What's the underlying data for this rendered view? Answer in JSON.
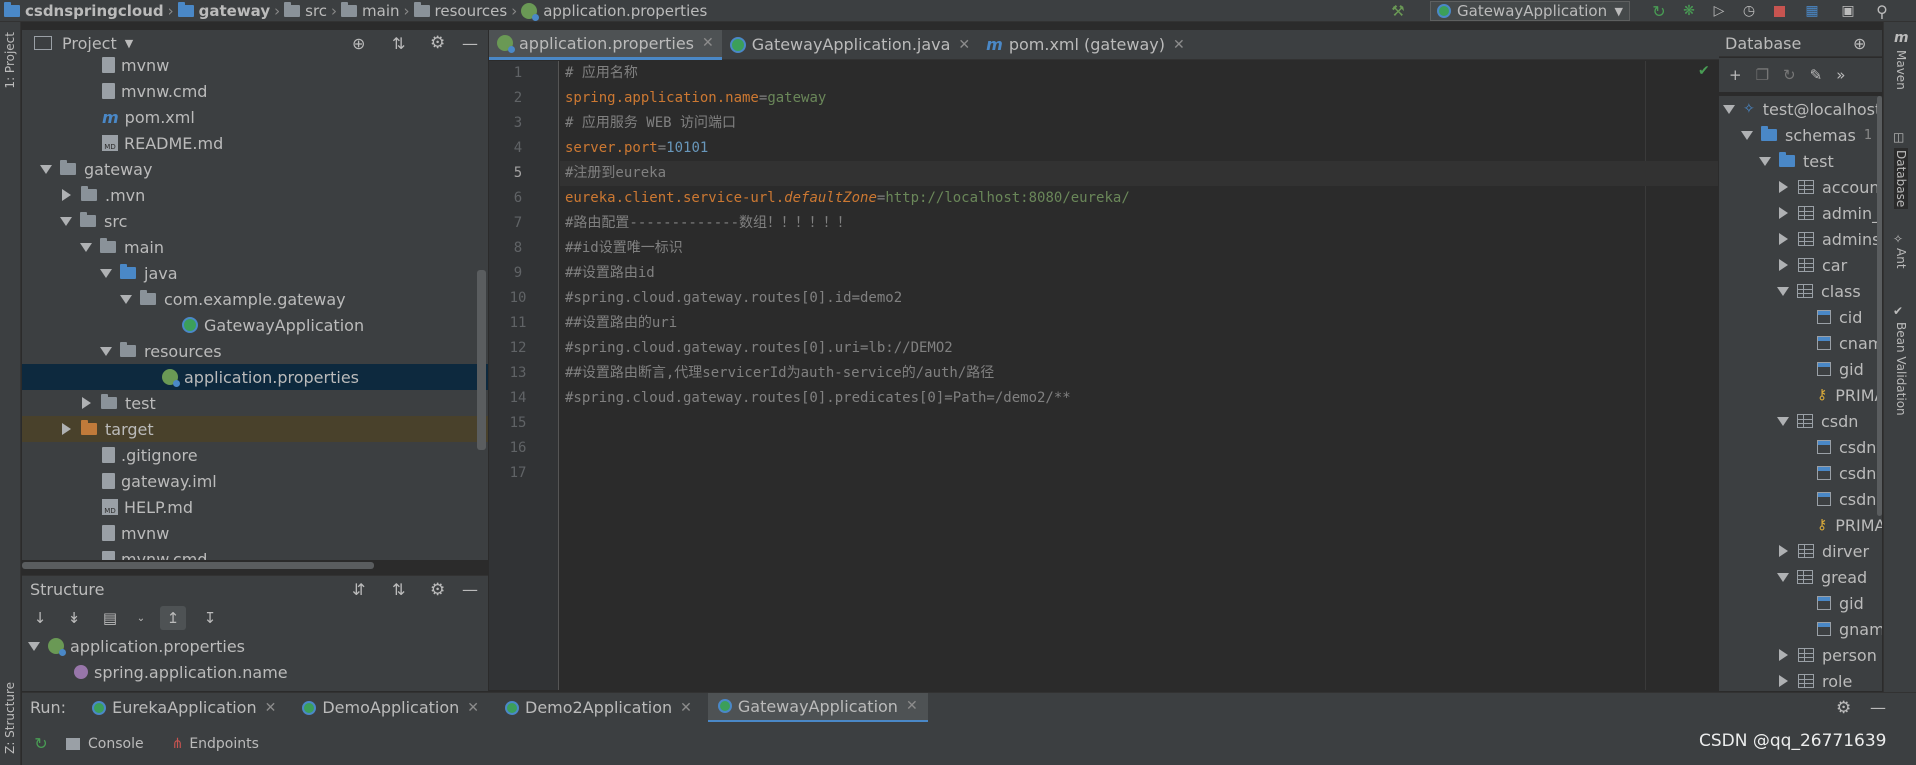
{
  "navbar": {
    "crumbs": [
      "csdnspringcloud",
      "gateway",
      "src",
      "main",
      "resources",
      "application.properties"
    ],
    "run_config": "GatewayApplication"
  },
  "leftstrip": {
    "project_tab": "1: Project",
    "structure_tab": "Z: Structure"
  },
  "project": {
    "title": "Project",
    "tree": [
      {
        "label": "mvnw",
        "icon": "file-icon",
        "depth": 3
      },
      {
        "label": "mvnw.cmd",
        "icon": "file-icon",
        "depth": 3
      },
      {
        "label": "pom.xml",
        "icon": "maven-icon",
        "depth": 3
      },
      {
        "label": "README.md",
        "icon": "markdown-icon",
        "depth": 3
      },
      {
        "label": "gateway",
        "icon": "folder-icon",
        "depth": 1,
        "expanded": true
      },
      {
        "label": ".mvn",
        "icon": "folder-icon",
        "depth": 2,
        "expanded": false
      },
      {
        "label": "src",
        "icon": "folder-icon",
        "depth": 2,
        "expanded": true
      },
      {
        "label": "main",
        "icon": "folder-icon",
        "depth": 3,
        "expanded": true
      },
      {
        "label": "java",
        "icon": "folder-blue-icon",
        "depth": 4,
        "expanded": true
      },
      {
        "label": "com.example.gateway",
        "icon": "package-icon",
        "depth": 5,
        "expanded": true
      },
      {
        "label": "GatewayApplication",
        "icon": "spring-class-icon",
        "depth": 7
      },
      {
        "label": "resources",
        "icon": "resources-folder-icon",
        "depth": 4,
        "expanded": true
      },
      {
        "label": "application.properties",
        "icon": "spring-leaf-icon",
        "depth": 6,
        "selected": true
      },
      {
        "label": "test",
        "icon": "folder-icon",
        "depth": 3,
        "expanded": false
      },
      {
        "label": "target",
        "icon": "folder-orange-icon",
        "depth": 2,
        "expanded": false,
        "highlight": true
      },
      {
        "label": ".gitignore",
        "icon": "file-icon",
        "depth": 3
      },
      {
        "label": "gateway.iml",
        "icon": "file-icon",
        "depth": 3
      },
      {
        "label": "HELP.md",
        "icon": "markdown-icon",
        "depth": 3
      },
      {
        "label": "mvnw",
        "icon": "file-icon",
        "depth": 3
      },
      {
        "label": "mvnw.cmd",
        "icon": "file-icon",
        "depth": 3
      }
    ]
  },
  "structure": {
    "title": "Structure",
    "tree": [
      {
        "label": "application.properties",
        "icon": "spring-leaf-icon"
      },
      {
        "label": "spring.application.name",
        "icon": "property-icon"
      }
    ]
  },
  "editor": {
    "tabs": [
      {
        "label": "application.properties",
        "active": true
      },
      {
        "label": "GatewayApplication.java",
        "active": false
      },
      {
        "label": "pom.xml (gateway)",
        "active": false
      }
    ],
    "current_line": 5,
    "lines": [
      [
        {
          "t": "# 应用名称",
          "c": "cmt"
        }
      ],
      [
        {
          "t": "spring.application.name",
          "c": "key"
        },
        {
          "t": "=",
          "c": "cmt"
        },
        {
          "t": "gateway",
          "c": "val"
        }
      ],
      [
        {
          "t": "# 应用服务 WEB 访问端口",
          "c": "cmt"
        }
      ],
      [
        {
          "t": "server.port",
          "c": "key"
        },
        {
          "t": "=",
          "c": "cmt"
        },
        {
          "t": "10101",
          "c": "num"
        }
      ],
      [
        {
          "t": "#注册到eureka",
          "c": "cmt"
        }
      ],
      [
        {
          "t": "eureka.client.service-url.",
          "c": "key"
        },
        {
          "t": "defaultZone",
          "c": "key it"
        },
        {
          "t": "=",
          "c": "cmt"
        },
        {
          "t": "http://localhost:8080/eureka/",
          "c": "val"
        }
      ],
      [
        {
          "t": "#路由配置-------------数组！！！！！！",
          "c": "cmt"
        }
      ],
      [
        {
          "t": "##id设置唯一标识",
          "c": "cmt"
        }
      ],
      [
        {
          "t": "##设置路由id",
          "c": "cmt"
        }
      ],
      [
        {
          "t": "#spring.cloud.gateway.routes[0].id=demo2",
          "c": "cmt"
        }
      ],
      [
        {
          "t": "##设置路由的uri",
          "c": "cmt"
        }
      ],
      [
        {
          "t": "#spring.cloud.gateway.routes[0].uri=lb://DEMO2",
          "c": "cmt"
        }
      ],
      [
        {
          "t": "##设置路由断言,代理servicerId为auth-service的/auth/路径",
          "c": "cmt"
        }
      ],
      [
        {
          "t": "#spring.cloud.gateway.routes[0].predicates[0]=Path=/demo2/**",
          "c": "cmt"
        }
      ],
      [],
      [],
      []
    ]
  },
  "database": {
    "title": "Database",
    "tree": [
      {
        "label": "test@localhost",
        "icon": "datasource-icon",
        "depth": 0,
        "expanded": true
      },
      {
        "label": "schemas",
        "icon": "folder-blue-icon",
        "depth": 1,
        "expanded": true,
        "count": "1"
      },
      {
        "label": "test",
        "icon": "schema-icon",
        "depth": 2,
        "expanded": true
      },
      {
        "label": "account",
        "icon": "table-icon",
        "depth": 3,
        "expanded": false
      },
      {
        "label": "admin_",
        "icon": "table-icon",
        "depth": 3,
        "expanded": false
      },
      {
        "label": "admins",
        "icon": "table-icon",
        "depth": 3,
        "expanded": false
      },
      {
        "label": "car",
        "icon": "table-icon",
        "depth": 3,
        "expanded": false
      },
      {
        "label": "class",
        "icon": "table-icon",
        "depth": 3,
        "expanded": true
      },
      {
        "label": "cid",
        "icon": "column-icon",
        "depth": 4
      },
      {
        "label": "cname",
        "icon": "column-icon",
        "depth": 4
      },
      {
        "label": "gid",
        "icon": "column-icon",
        "depth": 4
      },
      {
        "label": "PRIMARY",
        "icon": "key-icon",
        "depth": 4
      },
      {
        "label": "csdn",
        "icon": "table-icon",
        "depth": 3,
        "expanded": true
      },
      {
        "label": "csdn",
        "icon": "column-icon",
        "depth": 4
      },
      {
        "label": "csdn",
        "icon": "column-icon",
        "depth": 4
      },
      {
        "label": "csdn",
        "icon": "column-icon",
        "depth": 4
      },
      {
        "label": "PRIMARY",
        "icon": "key-icon",
        "depth": 4
      },
      {
        "label": "dirver",
        "icon": "table-icon",
        "depth": 3,
        "expanded": false
      },
      {
        "label": "gread",
        "icon": "table-icon",
        "depth": 3,
        "expanded": true
      },
      {
        "label": "gid",
        "icon": "column-icon",
        "depth": 4
      },
      {
        "label": "gname",
        "icon": "column-icon",
        "depth": 4
      },
      {
        "label": "person",
        "icon": "table-icon",
        "depth": 3,
        "expanded": false
      },
      {
        "label": "role",
        "icon": "table-icon",
        "depth": 3,
        "expanded": false
      }
    ]
  },
  "rightstrip": {
    "tabs": [
      "Maven",
      "Database",
      "Ant",
      "Bean Validation"
    ]
  },
  "run": {
    "label": "Run:",
    "tabs": [
      {
        "label": "EurekaApplication",
        "active": false
      },
      {
        "label": "DemoApplication",
        "active": false
      },
      {
        "label": "Demo2Application",
        "active": false
      },
      {
        "label": "GatewayApplication",
        "active": true
      }
    ],
    "subtabs": [
      "Console",
      "Endpoints"
    ]
  },
  "watermark": "CSDN @qq_26771639",
  "colors": {
    "accent": "#4a88c7",
    "selected": "#0d293e",
    "keyword": "#cc7832",
    "string": "#6a8759",
    "number": "#6897bb",
    "comment": "#808080"
  }
}
